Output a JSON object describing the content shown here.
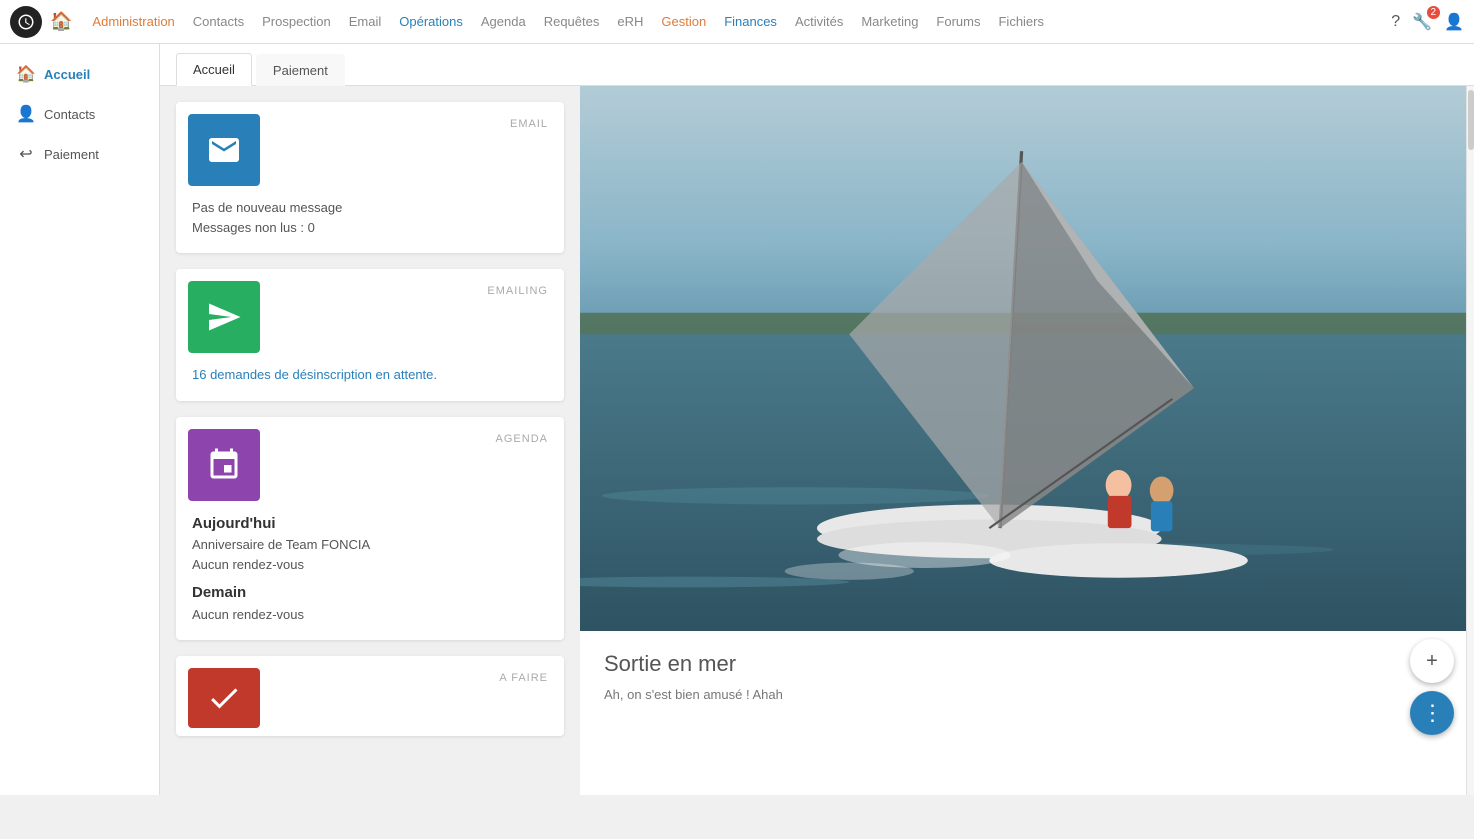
{
  "topnav": {
    "items": [
      {
        "label": "Administration",
        "class": "admin"
      },
      {
        "label": "Contacts",
        "class": "contacts"
      },
      {
        "label": "Prospection",
        "class": "prospection"
      },
      {
        "label": "Email",
        "class": "email"
      },
      {
        "label": "Opérations",
        "class": "operations"
      },
      {
        "label": "Agenda",
        "class": "agenda"
      },
      {
        "label": "Requêtes",
        "class": "requetes"
      },
      {
        "label": "eRH",
        "class": "erh"
      },
      {
        "label": "Gestion",
        "class": "gestion"
      },
      {
        "label": "Finances",
        "class": "finances"
      },
      {
        "label": "Activités",
        "class": "activites"
      },
      {
        "label": "Marketing",
        "class": "marketing"
      },
      {
        "label": "Forums",
        "class": "forums"
      },
      {
        "label": "Fichiers",
        "class": "fichiers"
      }
    ],
    "notification_count": "2"
  },
  "sidebar": {
    "items": [
      {
        "label": "Accueil",
        "icon": "🏠",
        "active": true
      },
      {
        "label": "Contacts",
        "icon": "👤",
        "active": false
      },
      {
        "label": "Paiement",
        "icon": "↩",
        "active": false
      }
    ]
  },
  "tabs": [
    {
      "label": "Accueil",
      "active": true
    },
    {
      "label": "Paiement",
      "active": false
    }
  ],
  "widgets": [
    {
      "id": "email",
      "icon_color": "blue",
      "label": "EMAIL",
      "lines": [
        {
          "text": "Pas de nouveau message",
          "style": "normal"
        },
        {
          "text": "Messages non lus : 0",
          "style": "normal"
        }
      ]
    },
    {
      "id": "emailing",
      "icon_color": "green",
      "label": "EMAILING",
      "lines": [
        {
          "text": "16 demandes de désinscription en attente.",
          "style": "link"
        }
      ]
    },
    {
      "id": "agenda",
      "icon_color": "purple",
      "label": "AGENDA",
      "lines": [
        {
          "text": "Aujourd'hui",
          "style": "bold"
        },
        {
          "text": "Anniversaire de Team FONCIA",
          "style": "normal"
        },
        {
          "text": "Aucun rendez-vous",
          "style": "normal"
        },
        {
          "text": "Demain",
          "style": "bold"
        },
        {
          "text": "",
          "style": "normal"
        },
        {
          "text": "Aucun rendez-vous",
          "style": "normal"
        }
      ]
    },
    {
      "id": "todo",
      "icon_color": "red",
      "label": "A FAIRE",
      "lines": []
    }
  ],
  "news": {
    "title": "Sortie en mer",
    "excerpt": "Ah, on s'est bien amusé ! Ahah"
  },
  "fab": {
    "add_label": "+",
    "menu_label": "⋮"
  }
}
